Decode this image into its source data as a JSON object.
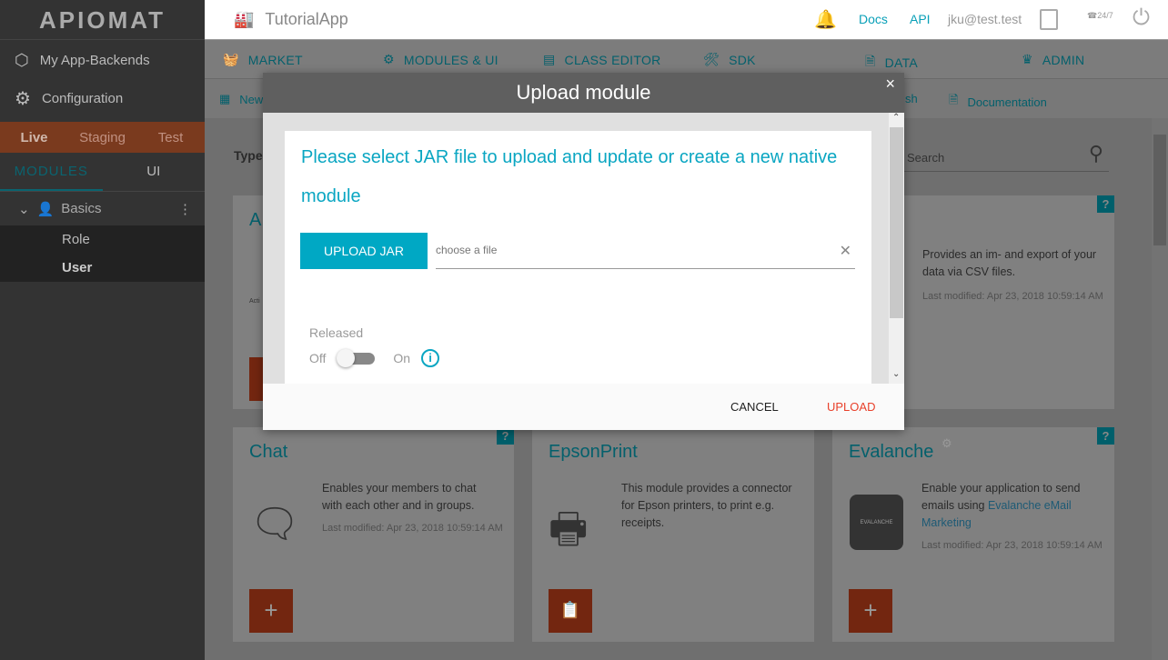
{
  "logo": "APIOMAT",
  "sidebar": {
    "items": [
      {
        "label": "My App-Backends",
        "icon": "cube-icon"
      },
      {
        "label": "Configuration",
        "icon": "gears-icon"
      }
    ],
    "envs": [
      "Live",
      "Staging",
      "Test"
    ],
    "active_env": "Live",
    "tabs": [
      "MODULES",
      "UI"
    ],
    "active_tab": "MODULES",
    "group": "Basics",
    "classes": [
      "Role",
      "User"
    ],
    "selected_class": "User"
  },
  "topbar": {
    "app": "TutorialApp",
    "docs": "Docs",
    "api": "API",
    "user": "jku@test.test",
    "support": "24/7"
  },
  "nav": [
    {
      "label": "MARKET",
      "icon": "basket-icon"
    },
    {
      "label": "MODULES & UI",
      "icon": "gear-icon"
    },
    {
      "label": "CLASS EDITOR",
      "icon": "class-editor-icon"
    },
    {
      "label": "SDK",
      "icon": "tools-icon"
    },
    {
      "label": "DATA",
      "icon": "document-icon"
    },
    {
      "label": "ADMIN",
      "icon": "crown-icon"
    }
  ],
  "subnav": {
    "new": "New",
    "publish": "sh",
    "documentation": "Documentation"
  },
  "filter": {
    "type_label": "Type",
    "search_placeholder": "Search"
  },
  "cards": [
    {
      "title": "A",
      "logo_text": "Acti",
      "desc": "",
      "modified": ""
    },
    {
      "title": "",
      "desc": "Provides an im- and export of your data via CSV files.",
      "modified": "Last modified: Apr 23, 2018 10:59:14 AM"
    },
    {
      "title": "Chat",
      "desc": "Enables your members to chat with each other and in groups.",
      "modified": "Last modified: Apr 23, 2018 10:59:14 AM",
      "action": "+"
    },
    {
      "title": "EpsonPrint",
      "desc": "This module provides a connector for Epson printers, to print e.g. receipts.",
      "modified": "",
      "action": "import"
    },
    {
      "title": "Evalanche",
      "desc_pre": "Enable your application to send emails using ",
      "desc_link": "Evalanche eMail Marketing",
      "modified": "Last modified: Apr 23, 2018 10:59:14 AM",
      "action": "+",
      "logo_text": "EVALANCHE"
    }
  ],
  "help": "?",
  "modal": {
    "title": "Upload module",
    "close": "×",
    "prompt": "Please select JAR file to upload and update or create a new native module",
    "upload_jar": "UPLOAD JAR",
    "file_placeholder": "choose a file",
    "file_value": "",
    "released_label": "Released",
    "off": "Off",
    "on": "On",
    "released": false,
    "cancel": "CANCEL",
    "upload": "UPLOAD"
  },
  "colors": {
    "accent": "#00a8c4",
    "upload": "#e8402a",
    "module_button": "#732610"
  }
}
